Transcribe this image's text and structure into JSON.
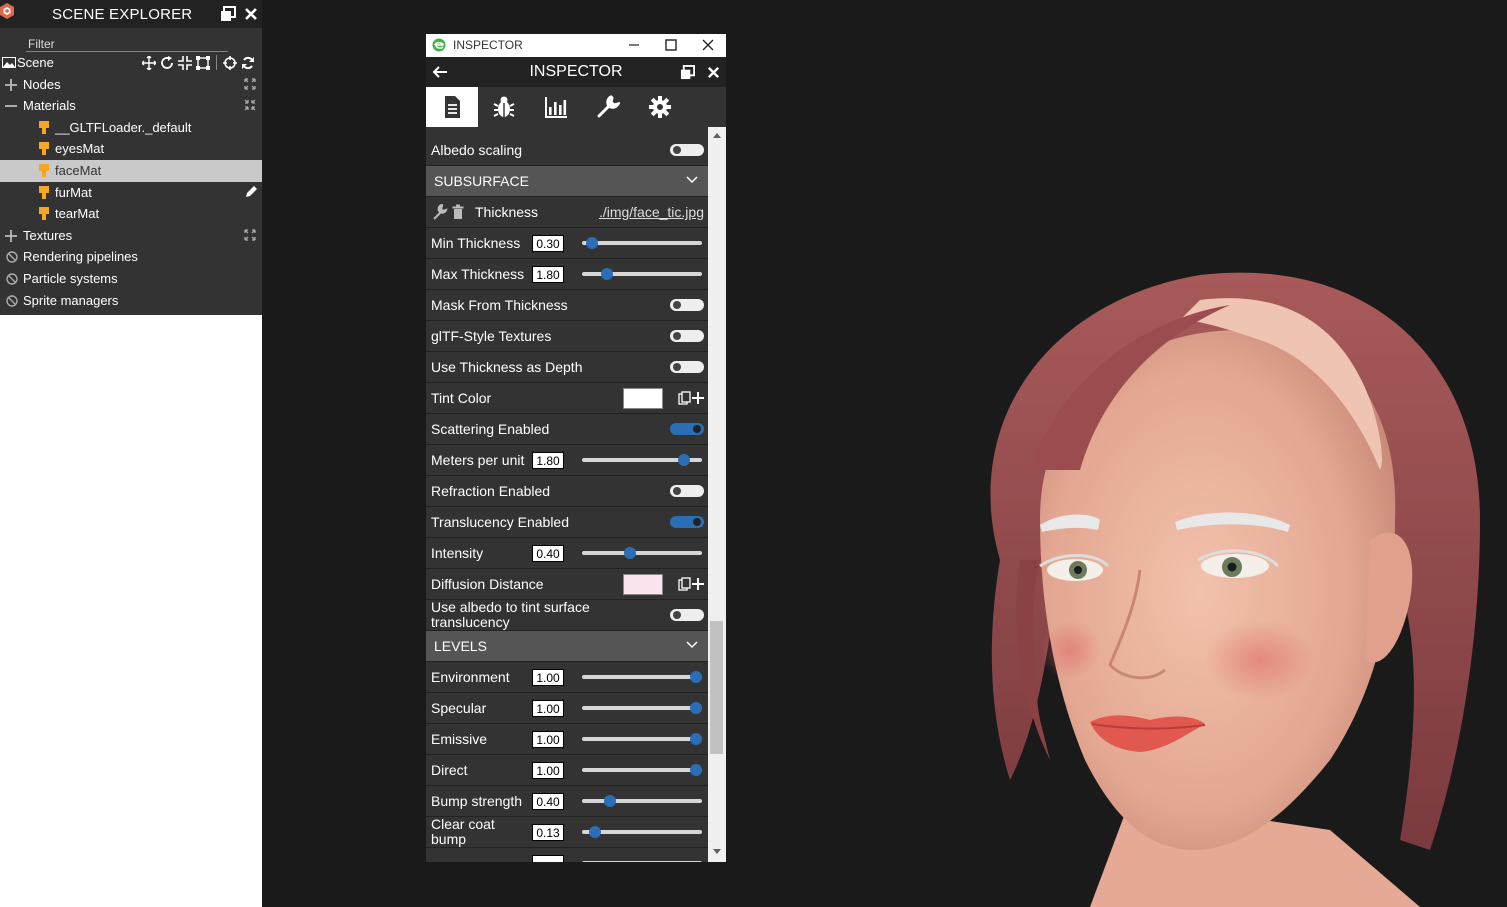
{
  "explorer": {
    "title": "SCENE EXPLORER",
    "filter_placeholder": "Filter",
    "scene_label": "Scene",
    "nodes_label": "Nodes",
    "materials_label": "Materials",
    "materials": [
      "__GLTFLoader._default",
      "eyesMat",
      "faceMat",
      "furMat",
      "tearMat"
    ],
    "selected_material": "faceMat",
    "textures_label": "Textures",
    "rendering_pipelines_label": "Rendering pipelines",
    "particle_systems_label": "Particle systems",
    "sprite_managers_label": "Sprite managers"
  },
  "inspector": {
    "window_title": "INSPECTOR",
    "header_title": "INSPECTOR",
    "tabs": [
      "properties-icon",
      "debug-icon",
      "statistics-icon",
      "tools-icon",
      "settings-icon"
    ],
    "active_tab": 0,
    "albedo_scaling": {
      "label": "Albedo scaling",
      "on": false
    },
    "subsurface": {
      "title": "SUBSURFACE",
      "thickness_label": "Thickness",
      "thickness_texture": "./img/face_tic.jpg",
      "min_thickness": {
        "label": "Min Thickness",
        "value": "0.30",
        "fraction": 0.08
      },
      "max_thickness": {
        "label": "Max Thickness",
        "value": "1.80",
        "fraction": 0.21
      },
      "mask_from_thickness": {
        "label": "Mask From Thickness",
        "on": false
      },
      "gltf_style_textures": {
        "label": "glTF-Style Textures",
        "on": false
      },
      "use_thickness_as_depth": {
        "label": "Use Thickness as Depth",
        "on": false
      },
      "tint_color": {
        "label": "Tint Color",
        "color": "#ffffff"
      },
      "scattering_enabled": {
        "label": "Scattering Enabled",
        "on": true
      },
      "meters_per_unit": {
        "label": "Meters per unit",
        "value": "1.80",
        "fraction": 0.85
      },
      "refraction_enabled": {
        "label": "Refraction Enabled",
        "on": false
      },
      "translucency_enabled": {
        "label": "Translucency Enabled",
        "on": true
      },
      "intensity": {
        "label": "Intensity",
        "value": "0.40",
        "fraction": 0.4
      },
      "diffusion_distance": {
        "label": "Diffusion Distance",
        "color": "#fbe3ef"
      },
      "use_albedo_to_tint": {
        "label": "Use albedo to tint surface translucency",
        "on": false
      }
    },
    "levels": {
      "title": "LEVELS",
      "environment": {
        "label": "Environment",
        "value": "1.00",
        "fraction": 0.95
      },
      "specular": {
        "label": "Specular",
        "value": "1.00",
        "fraction": 0.95
      },
      "emissive": {
        "label": "Emissive",
        "value": "1.00",
        "fraction": 0.95
      },
      "direct": {
        "label": "Direct",
        "value": "1.00",
        "fraction": 0.95
      },
      "bump_strength": {
        "label": "Bump strength",
        "value": "0.40",
        "fraction": 0.23
      },
      "clear_coat_bump": {
        "label": "Clear coat bump",
        "value": "0.13",
        "fraction": 0.11
      }
    }
  },
  "colors": {
    "accent": "#2a6fb6",
    "panel": "#333333",
    "header": "#222222",
    "section": "#555555",
    "material_icon": "#f5a623"
  }
}
